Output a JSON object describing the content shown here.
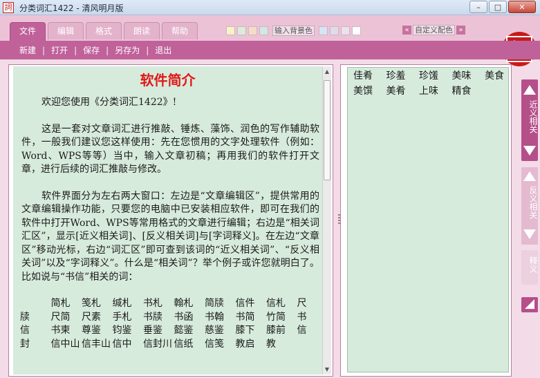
{
  "window": {
    "icon_char": "詞",
    "title": "分类词汇1422 - 清风明月版",
    "buttons": {
      "minimize": "–",
      "maximize": "□",
      "close": "✕"
    }
  },
  "ribbon": {
    "tabs": [
      "文件",
      "编辑",
      "格式",
      "朗读",
      "帮助"
    ],
    "active_tab": "文件",
    "swatches_left": [
      "#f7f3c6",
      "#dbecd8",
      "#f5dcc6",
      "#d0e7e3"
    ],
    "bg_button": "输入背景色",
    "swatches_right": [
      "#d2e6f5",
      "#dfdcea",
      "#ebe2ea",
      "#ffffff"
    ],
    "custom_color_label": "自定义配色",
    "custom_prev": "«",
    "custom_next": "»",
    "stamp_char": "詞"
  },
  "menu": [
    "新建",
    "打开",
    "保存",
    "另存为",
    "退出"
  ],
  "editor": {
    "title": "软件简介",
    "paragraphs": [
      "欢迎您使用《分类词汇1422》!",
      "这是一套对文章词汇进行推敲、锤炼、藻饰、润色的写作辅助软件，一般我们建议您这样使用：先在您惯用的文字处理软件（例如：Word、WPS等等）当中，输入文章初稿；再用我们的软件打开文章，进行后续的词汇推敲与修改。",
      "软件界面分为左右两大窗口：左边是“文章编辑区”，提供常用的文章编辑操作功能，只要您的电脑中已安装相应软件，即可在我们的软件中打开Word、WPS等常用格式的文章进行编辑；右边是“相关词汇区”，显示[近义相关词]、[反义相关词]与[字词释义]。在左边“文章区”移动光标，右边“词汇区”即可查到该词的“近义相关词”、“反义相关词”以及“字词释义”。什么是“相关词”？举个例子或许您就明白了。比如说与“书信”相关的词："
    ],
    "word_rows": [
      [
        "",
        "简札",
        "笺札",
        "缄札",
        "书札",
        "翰札",
        "简牍",
        "信件",
        "信札",
        "尺"
      ],
      [
        "牍",
        "尺简",
        "尺素",
        "手札",
        "书牍",
        "书函",
        "书翰",
        "书简",
        "竹简",
        "书"
      ],
      [
        "信",
        "书柬",
        "尊鉴",
        "钧鉴",
        "垂鉴",
        "懿鉴",
        "慈鉴",
        "膝下",
        "膝前",
        "信"
      ],
      [
        "封",
        "信中山",
        "信丰山",
        "信中",
        "信封川",
        "信纸",
        "信笺",
        "教启",
        "教"
      ]
    ]
  },
  "results": {
    "words": [
      "佳肴",
      "珍羞",
      "珍馐",
      "美味",
      "美食",
      "美馔",
      "美肴",
      "上味",
      "精食"
    ]
  },
  "sidenav": {
    "synonym_label": "近义相关",
    "antonym_label": "反义相关",
    "definition_label": "释义"
  }
}
